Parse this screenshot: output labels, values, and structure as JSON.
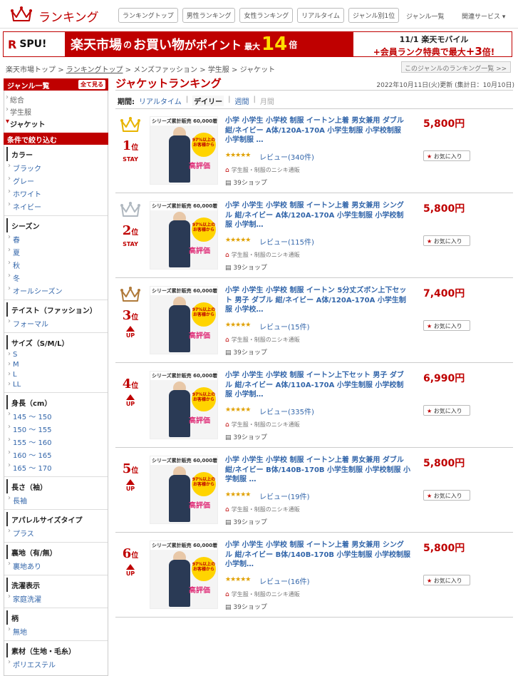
{
  "header": {
    "logo_text": "ランキング",
    "nav": [
      "ランキングトップ",
      "男性ランキング",
      "女性ランキング",
      "リアルタイム",
      "ジャンル別1位"
    ],
    "links": [
      "ジャンル一覧",
      "関連サービス ▾"
    ]
  },
  "banner": {
    "spu_r": "R",
    "spu": "SPU!",
    "line1": "楽天市場",
    "line2": "の",
    "line3": "お買い物",
    "line3b": "がポイント",
    "line4": "最大",
    "num": "14",
    "unit": "倍",
    "right1": "11/1 楽天モバイル",
    "right2_a": "+会員ランク特典で最大",
    "right2_b": "+3",
    "right2_c": "倍!"
  },
  "breadcrumb": {
    "items": [
      "楽天市場トップ",
      "ランキングトップ",
      "メンズファッション",
      "学生服",
      "ジャケット"
    ],
    "sep": ">",
    "genre_button": "このジャンルのランキング一覧 >>"
  },
  "sidebar": {
    "genre_title": "ジャンル一覧",
    "see_all": "全て見る",
    "genres": [
      {
        "label": "総合",
        "current": false
      },
      {
        "label": "学生服",
        "current": false
      },
      {
        "label": "ジャケット",
        "current": true
      }
    ],
    "filter_title": "条件で絞り込む",
    "filters": [
      {
        "title": "カラー",
        "options": [
          "ブラック",
          "グレー",
          "ホワイト",
          "ネイビー"
        ]
      },
      {
        "title": "シーズン",
        "options": [
          "春",
          "夏",
          "秋",
          "冬",
          "オールシーズン"
        ]
      },
      {
        "title": "テイスト（ファッション）",
        "options": [
          "フォーマル"
        ]
      },
      {
        "title": "サイズ（S/M/L）",
        "options": [
          "S",
          "M",
          "L",
          "LL"
        ]
      },
      {
        "title": "身長（cm）",
        "options": [
          "145 ～ 150",
          "150 ～ 155",
          "155 ～ 160",
          "160 ～ 165",
          "165 ～ 170"
        ]
      },
      {
        "title": "長さ（袖）",
        "options": [
          "長袖"
        ]
      },
      {
        "title": "アパレルサイズタイプ",
        "options": [
          "プラス"
        ]
      },
      {
        "title": "裏地（有/無）",
        "options": [
          "裏地あり"
        ]
      },
      {
        "title": "洗濯表示",
        "options": [
          "家庭洗濯"
        ]
      },
      {
        "title": "柄",
        "options": [
          "無地"
        ]
      },
      {
        "title": "素材（生地・毛糸）",
        "options": [
          "ポリエステル"
        ]
      }
    ]
  },
  "main": {
    "title": "ジャケットランキング",
    "date": "2022年10月11日(火)更新 (集計日：10月10日)",
    "period_label": "期間:",
    "periods": [
      {
        "label": "リアルタイム",
        "state": "link"
      },
      {
        "label": "デイリー",
        "state": "active"
      },
      {
        "label": "週間",
        "state": "link"
      },
      {
        "label": "月間",
        "state": "disabled"
      }
    ],
    "period_sep": "|"
  },
  "product_common": {
    "thumb_bar": "シリーズ累計販売 60,000着突破",
    "thumb_circle": "97%以上のお客様から",
    "thumb_hyoka": "高評価",
    "shop_sub": "学生服・制服のニシキ通販",
    "shop_count": "39ショップ",
    "fav_label": "お気に入り",
    "rank_suffix": "位",
    "stars": "★★★★★"
  },
  "products": [
    {
      "rank": "1",
      "crown": "gold",
      "status": "STAY",
      "name": "小学 小学生 小学校 制服 イートン上着 男女兼用 ダブル 紺/ネイビー A体/120A-170A 小学生制服 小学校制服 小学制服 …",
      "review": "レビュー(340件)",
      "price": "5,800円"
    },
    {
      "rank": "2",
      "crown": "silver",
      "status": "STAY",
      "name": "小学 小学生 小学校 制服 イートン上着 男女兼用 シングル 紺/ネイビー A体/120A-170A 小学生制服 小学校制服 小学制…",
      "review": "レビュー(115件)",
      "price": "5,800円"
    },
    {
      "rank": "3",
      "crown": "bronze",
      "status": "UP",
      "name": "小学 小学生 小学校 制服 イートン 5分丈ズボン上下セット 男子 ダブル 紺/ネイビー A体/120A-170A 小学生制服 小学校…",
      "review": "レビュー(15件)",
      "price": "7,400円"
    },
    {
      "rank": "4",
      "crown": "",
      "status": "UP",
      "name": "小学 小学生 小学校 制服 イートン上下セット 男子 ダブル 紺/ネイビー A体/110A-170A 小学生制服 小学校制服 小学制…",
      "review": "レビュー(335件)",
      "price": "6,990円"
    },
    {
      "rank": "5",
      "crown": "",
      "status": "UP",
      "name": "小学 小学生 小学校 制服 イートン上着 男女兼用 ダブル 紺/ネイビー B体/140B-170B 小学生制服 小学校制服 小学制服 …",
      "review": "レビュー(19件)",
      "price": "5,800円"
    },
    {
      "rank": "6",
      "crown": "",
      "status": "UP",
      "name": "小学 小学生 小学校 制服 イートン上着 男女兼用 シングル 紺/ネイビー B体/140B-170B 小学生制服 小学校制服 小学制…",
      "review": "レビュー(16件)",
      "price": "5,800円"
    }
  ],
  "colors": {
    "brand": "#bf0000",
    "link": "#3366aa",
    "gold": "#e8b400",
    "silver": "#b0b8c0",
    "bronze": "#b07a3a"
  }
}
